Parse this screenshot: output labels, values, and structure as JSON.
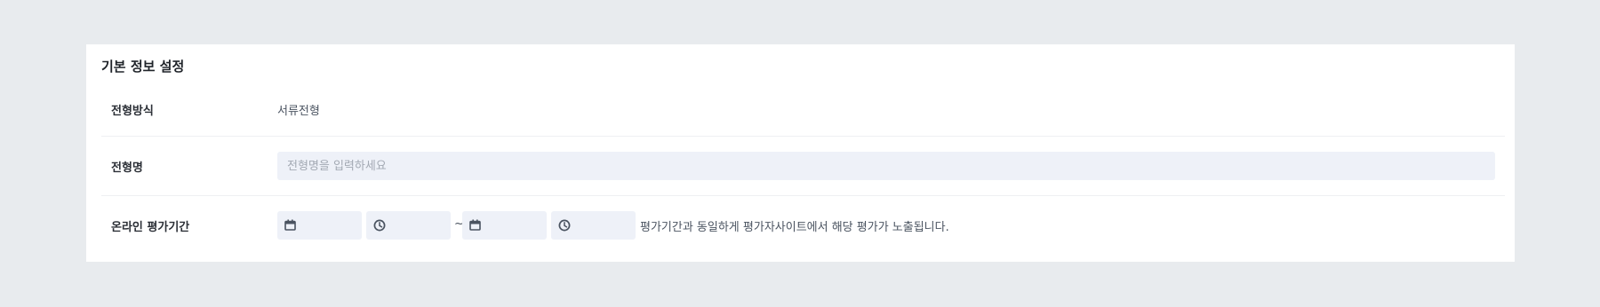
{
  "section": {
    "title": "기본 정보 설정"
  },
  "rows": {
    "type": {
      "label": "전형방식",
      "value": "서류전형"
    },
    "name": {
      "label": "전형명",
      "placeholder": "전형명을 입력하세요",
      "value": ""
    },
    "period": {
      "label": "온라인 평가기간",
      "separator": "~",
      "note": "평가기간과 동일하게 평가자사이트에서 해당 평가가 노출됩니다."
    }
  },
  "icons": {
    "start_date": "calendar-icon",
    "start_time": "clock-icon",
    "end_date": "calendar-icon",
    "end_time": "clock-icon"
  },
  "colors": {
    "page_background": "#e8ebee",
    "card_background": "#ffffff",
    "input_background": "#eef1f8",
    "placeholder_text": "#a3a9b3"
  }
}
